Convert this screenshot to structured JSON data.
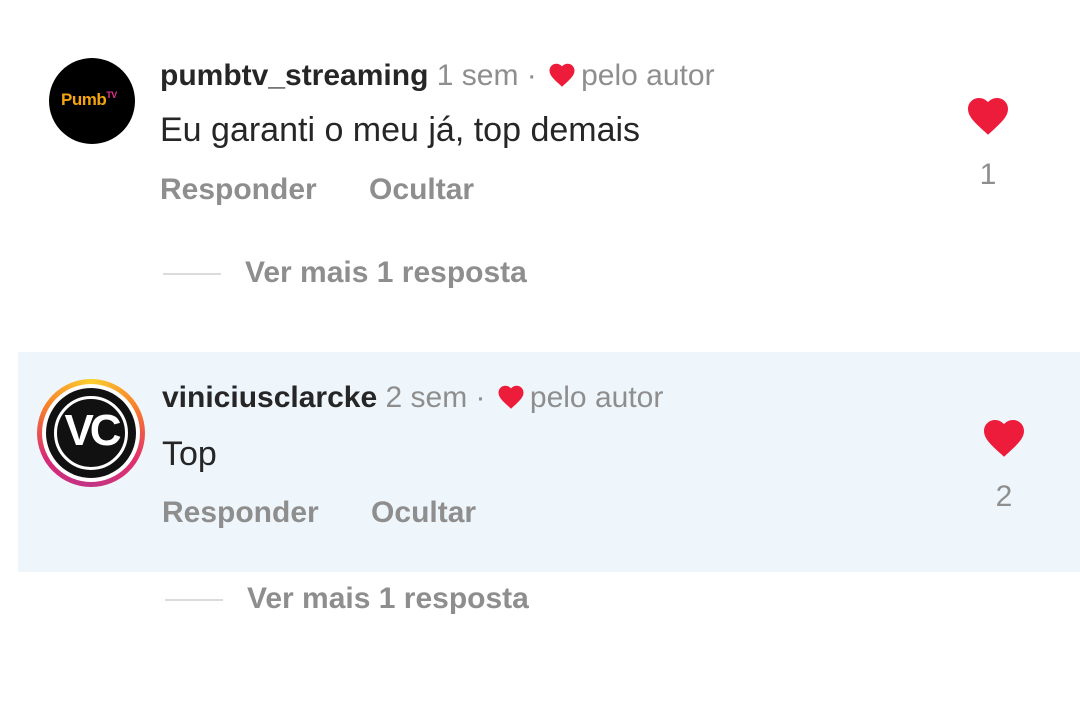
{
  "colors": {
    "like_red": "#ed1c3a",
    "meta_gray": "#8e8e8e",
    "highlight_bg": "#eff6fb"
  },
  "comments": [
    {
      "username": "pumbtv_streaming",
      "time": "1 sem",
      "separator": "·",
      "liked_by_author": "pelo autor",
      "text": "Eu garanti o meu já, top demais",
      "reply_label": "Responder",
      "hide_label": "Ocultar",
      "like_count": "1",
      "view_replies": "Ver mais 1 resposta",
      "avatar_icon": "pumbtv-logo-icon"
    },
    {
      "username": "viniciusclarcke",
      "time": "2 sem",
      "separator": "·",
      "liked_by_author": "pelo autor",
      "text": "Top",
      "reply_label": "Responder",
      "hide_label": "Ocultar",
      "like_count": "2",
      "view_replies": "Ver mais 1 resposta",
      "avatar_icon": "vc-logo-icon"
    }
  ]
}
